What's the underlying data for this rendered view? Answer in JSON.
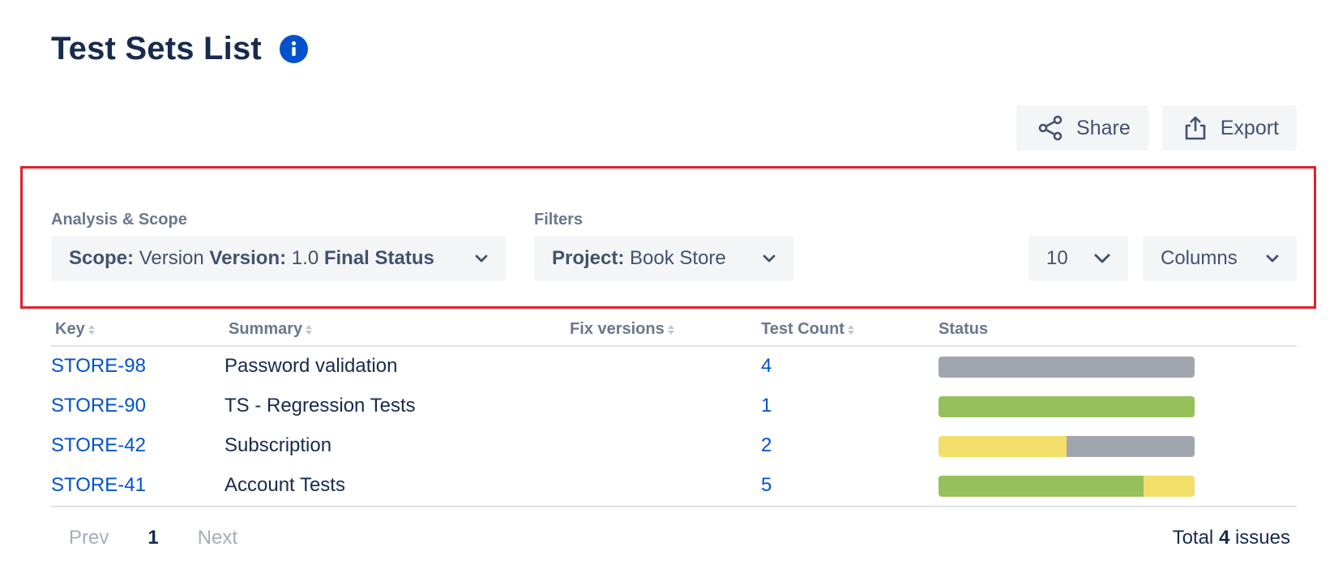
{
  "page": {
    "title": "Test Sets List"
  },
  "toolbar": {
    "share_label": "Share",
    "export_label": "Export"
  },
  "analysis": {
    "label": "Analysis & Scope",
    "scope_key": "Scope:",
    "scope_value": "Version",
    "version_key": "Version:",
    "version_value": "1.0",
    "status_key": "Final Status"
  },
  "filters": {
    "label": "Filters",
    "project_key": "Project:",
    "project_value": "Book Store"
  },
  "page_size": {
    "value": "10"
  },
  "columns_dropdown": {
    "label": "Columns"
  },
  "table": {
    "headers": {
      "key": "Key",
      "summary": "Summary",
      "fix_versions": "Fix versions",
      "test_count": "Test Count",
      "status": "Status"
    },
    "rows": [
      {
        "key": "STORE-98",
        "summary": "Password validation",
        "fix_versions": "",
        "test_count": "4",
        "status": [
          {
            "color": "#a1a6ae",
            "fraction": 1.0
          }
        ]
      },
      {
        "key": "STORE-90",
        "summary": "TS - Regression Tests",
        "fix_versions": "",
        "test_count": "1",
        "status": [
          {
            "color": "#95c05a",
            "fraction": 1.0
          }
        ]
      },
      {
        "key": "STORE-42",
        "summary": "Subscription",
        "fix_versions": "",
        "test_count": "2",
        "status": [
          {
            "color": "#f1df6a",
            "fraction": 0.5
          },
          {
            "color": "#a1a6ae",
            "fraction": 0.5
          }
        ]
      },
      {
        "key": "STORE-41",
        "summary": "Account Tests",
        "fix_versions": "",
        "test_count": "5",
        "status": [
          {
            "color": "#95c05a",
            "fraction": 0.8
          },
          {
            "color": "#f1df6a",
            "fraction": 0.2
          }
        ]
      }
    ]
  },
  "pagination": {
    "prev": "Prev",
    "current": "1",
    "next": "Next"
  },
  "total": {
    "prefix": "Total",
    "count": "4",
    "suffix": "issues"
  },
  "colors": {
    "link": "#0052cc",
    "accent": "#0052cc",
    "highlight": "#e0202a"
  }
}
